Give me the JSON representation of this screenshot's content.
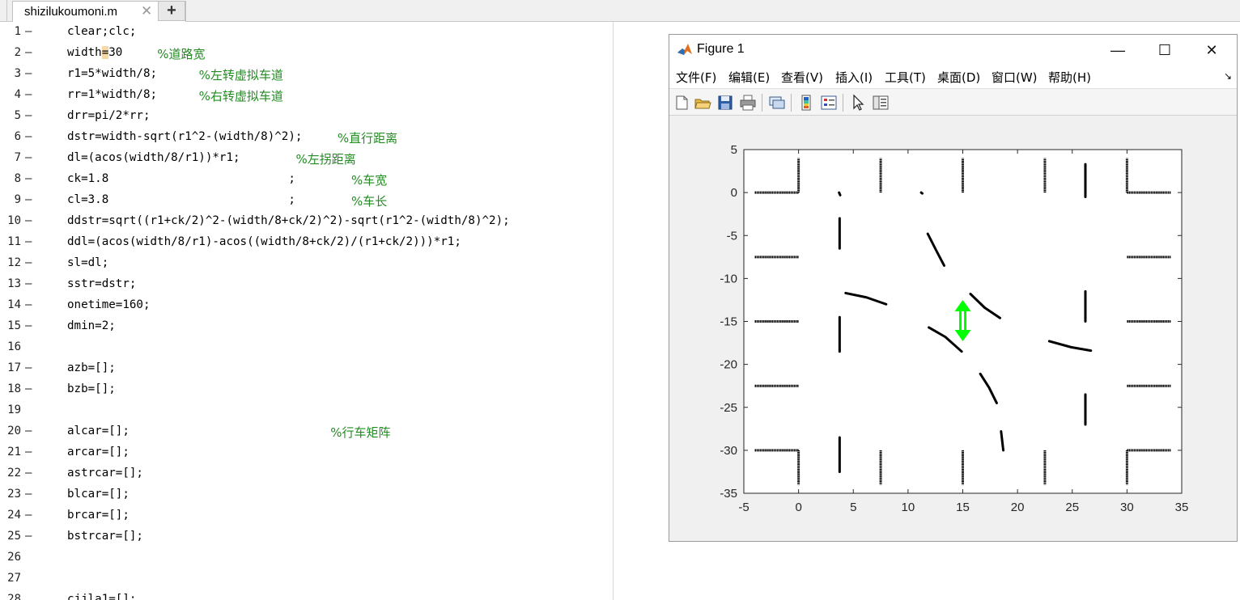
{
  "editor": {
    "tab_label": "shizilukoumoni.m",
    "close_glyph": "✕",
    "new_tab_glyph": "+",
    "line_dash": "—",
    "lines": [
      {
        "n": "1",
        "code": "clear;clc;",
        "comment": ""
      },
      {
        "n": "2",
        "code": "width=30",
        "comment": "%道路宽"
      },
      {
        "n": "3",
        "code": "r1=5*width/8;",
        "comment": "%左转虚拟车道"
      },
      {
        "n": "4",
        "code": "rr=1*width/8;",
        "comment": "%右转虚拟车道"
      },
      {
        "n": "5",
        "code": "drr=pi/2*rr;",
        "comment": ""
      },
      {
        "n": "6",
        "code": "dstr=width-sqrt(r1^2-(width/8)^2);",
        "comment": "%直行距离"
      },
      {
        "n": "7",
        "code": "dl=(acos(width/8/r1))*r1;",
        "comment": "%左拐距离"
      },
      {
        "n": "8",
        "code": "ck=1.8                          ;",
        "comment": "%车宽"
      },
      {
        "n": "9",
        "code": "cl=3.8                          ;",
        "comment": "%车长"
      },
      {
        "n": "10",
        "code": "ddstr=sqrt((r1+ck/2)^2-(width/8+ck/2)^2)-sqrt(r1^2-(width/8)^2);",
        "comment": ""
      },
      {
        "n": "11",
        "code": "ddl=(acos(width/8/r1)-acos((width/8+ck/2)/(r1+ck/2)))*r1;",
        "comment": ""
      },
      {
        "n": "12",
        "code": "sl=dl;",
        "comment": ""
      },
      {
        "n": "13",
        "code": "sstr=dstr;",
        "comment": ""
      },
      {
        "n": "14",
        "code": "onetime=160;",
        "comment": ""
      },
      {
        "n": "15",
        "code": "dmin=2;",
        "comment": ""
      },
      {
        "n": "16",
        "code": "",
        "comment": ""
      },
      {
        "n": "17",
        "code": "azb=[];",
        "comment": ""
      },
      {
        "n": "18",
        "code": "bzb=[];",
        "comment": ""
      },
      {
        "n": "19",
        "code": "",
        "comment": ""
      },
      {
        "n": "20",
        "code": "alcar=[];",
        "comment": "%行车矩阵"
      },
      {
        "n": "21",
        "code": "arcar=[];",
        "comment": ""
      },
      {
        "n": "22",
        "code": "astrcar=[];",
        "comment": ""
      },
      {
        "n": "23",
        "code": "blcar=[];",
        "comment": ""
      },
      {
        "n": "24",
        "code": "brcar=[];",
        "comment": ""
      },
      {
        "n": "25",
        "code": "bstrcar=[];",
        "comment": ""
      },
      {
        "n": "26",
        "code": "",
        "comment": ""
      },
      {
        "n": "27",
        "code": "",
        "comment": ""
      },
      {
        "n": "28",
        "code": "cjjla1=[];",
        "comment": ""
      }
    ]
  },
  "figure": {
    "title": "Figure 1",
    "minimize_glyph": "—",
    "maximize_glyph": "☐",
    "close_glyph": "✕",
    "menu": [
      "文件(F)",
      "编辑(E)",
      "查看(V)",
      "插入(I)",
      "工具(T)",
      "桌面(D)",
      "窗口(W)",
      "帮助(H)"
    ],
    "menu_overflow_glyph": "↘",
    "toolbar_icons": [
      "new-figure-icon",
      "open-file-icon",
      "save-icon",
      "print-icon",
      "link-plot-icon",
      "colorbar-icon",
      "legend-icon",
      "edit-plot-icon",
      "property-inspector-icon"
    ]
  },
  "chart_data": {
    "type": "scatter",
    "title": "",
    "xlabel": "",
    "ylabel": "",
    "xlim": [
      -5,
      35
    ],
    "ylim": [
      -35,
      5
    ],
    "xticks": [
      "-5",
      "0",
      "5",
      "10",
      "15",
      "20",
      "25",
      "30",
      "35"
    ],
    "yticks": [
      "5",
      "0",
      "-5",
      "-10",
      "-15",
      "-20",
      "-25",
      "-30",
      "-35"
    ],
    "grid": false,
    "road_lines": [
      {
        "x": [
          -4,
          0
        ],
        "y": [
          0,
          0
        ]
      },
      {
        "x": [
          0,
          0
        ],
        "y": [
          0,
          4
        ]
      },
      {
        "x": [
          30,
          30
        ],
        "y": [
          0,
          4
        ]
      },
      {
        "x": [
          30,
          34
        ],
        "y": [
          0,
          0
        ]
      },
      {
        "x": [
          -4,
          0
        ],
        "y": [
          -30,
          -30
        ]
      },
      {
        "x": [
          0,
          0
        ],
        "y": [
          -30,
          -34
        ]
      },
      {
        "x": [
          30,
          34
        ],
        "y": [
          -30,
          -30
        ]
      },
      {
        "x": [
          30,
          30
        ],
        "y": [
          -30,
          -34
        ]
      },
      {
        "x": [
          -4,
          0
        ],
        "y": [
          -7.5,
          -7.5
        ]
      },
      {
        "x": [
          -4,
          0
        ],
        "y": [
          -15,
          -15
        ]
      },
      {
        "x": [
          -4,
          0
        ],
        "y": [
          -22.5,
          -22.5
        ]
      },
      {
        "x": [
          30,
          34
        ],
        "y": [
          -7.5,
          -7.5
        ]
      },
      {
        "x": [
          30,
          34
        ],
        "y": [
          -15,
          -15
        ]
      },
      {
        "x": [
          30,
          34
        ],
        "y": [
          -22.5,
          -22.5
        ]
      },
      {
        "x": [
          7.5,
          7.5
        ],
        "y": [
          0,
          4
        ]
      },
      {
        "x": [
          15,
          15
        ],
        "y": [
          0,
          4
        ]
      },
      {
        "x": [
          22.5,
          22.5
        ],
        "y": [
          0,
          4
        ]
      },
      {
        "x": [
          7.5,
          7.5
        ],
        "y": [
          -30,
          -34
        ]
      },
      {
        "x": [
          15,
          15
        ],
        "y": [
          -30,
          -34
        ]
      },
      {
        "x": [
          22.5,
          22.5
        ],
        "y": [
          -30,
          -34
        ]
      }
    ],
    "vehicle_paths": [
      {
        "x": [
          3.7,
          3.8
        ],
        "y": [
          0,
          -0.3
        ]
      },
      {
        "x": [
          3.75,
          3.75
        ],
        "y": [
          -3,
          -6.5
        ]
      },
      {
        "x": [
          3.75,
          3.75
        ],
        "y": [
          -14.5,
          -18.5
        ]
      },
      {
        "x": [
          3.75,
          3.75
        ],
        "y": [
          -28.5,
          -32.5
        ]
      },
      {
        "x": [
          26.2,
          26.2
        ],
        "y": [
          3.3,
          -0.5
        ]
      },
      {
        "x": [
          26.2,
          26.2
        ],
        "y": [
          -11.5,
          -15
        ]
      },
      {
        "x": [
          26.2,
          26.2
        ],
        "y": [
          -23.5,
          -27
        ]
      },
      {
        "x": [
          11.8,
          12.6,
          13.3
        ],
        "y": [
          -4.8,
          -6.8,
          -8.5
        ]
      },
      {
        "x": [
          4.3,
          6.2,
          8
        ],
        "y": [
          -11.7,
          -12.2,
          -13
        ]
      },
      {
        "x": [
          11.9,
          13.4,
          14.9
        ],
        "y": [
          -15.7,
          -16.8,
          -18.5
        ]
      },
      {
        "x": [
          15.7,
          17,
          18.4
        ],
        "y": [
          -11.8,
          -13.4,
          -14.6
        ]
      },
      {
        "x": [
          22.9,
          24.9,
          26.7
        ],
        "y": [
          -17.3,
          -18,
          -18.4
        ]
      },
      {
        "x": [
          16.6,
          17.4,
          18.1
        ],
        "y": [
          -21.1,
          -22.7,
          -24.5
        ]
      },
      {
        "x": [
          18.5,
          18.7
        ],
        "y": [
          -27.8,
          -30
        ]
      },
      {
        "x": [
          11.2,
          11.3
        ],
        "y": [
          0,
          -0.1
        ]
      }
    ],
    "highlight_arrow": {
      "x": 15,
      "y": [
        -12.5,
        -17.3
      ],
      "color": "#00ff00"
    },
    "line_color": "#000000"
  }
}
